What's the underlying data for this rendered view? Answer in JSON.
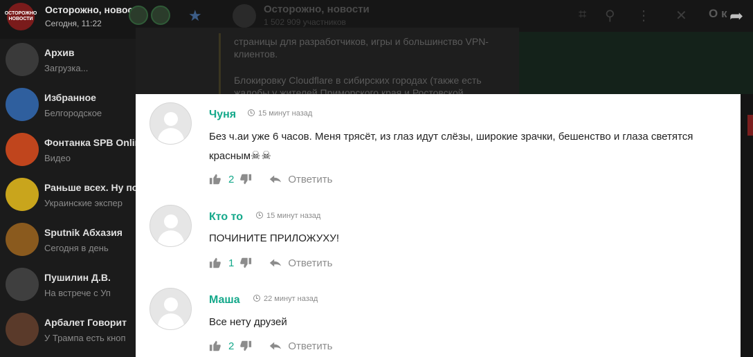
{
  "topbar": {
    "channel_logo_text": "ОСТОРОЖНО НОВОСТИ",
    "title": "Осторожно, новости",
    "time": "Сегодня, 11:22",
    "chat_title": "Осторожно, новости",
    "chat_subscribers": "1 502 909 участников",
    "right_partial": "О к"
  },
  "sidebar": {
    "chats": [
      {
        "name": "Архив",
        "preview": "Загрузка...",
        "avatar_color": "#3a3a3a"
      },
      {
        "name": "Избранное",
        "preview": "Белгородское",
        "avatar_color": "#2f5f9e"
      },
      {
        "name": "Фонтанка SPB Onlin",
        "preview": "Видео",
        "avatar_color": "#c0451d"
      },
      {
        "name": "Раньше всех. Ну по",
        "preview": "Украинские экспер",
        "avatar_color": "#c9a51c"
      },
      {
        "name": "Sputnik Абхазия",
        "preview": "Сегодня в день",
        "avatar_color": "#8a5a1e"
      },
      {
        "name": "Пушилин Д.В.",
        "preview": "На встрече с Уп",
        "avatar_color": "#3f3f3f"
      },
      {
        "name": "Арбалет Говорит",
        "preview": "У Трампа есть кноп",
        "avatar_color": "#5a3a2a"
      }
    ]
  },
  "background_message": {
    "lines": [
      "страницы для разработчиков, игры и большинство VPN-",
      "клиентов.",
      "Блокировку Cloudflare в сибирских городах (также есть",
      "жалобы у жителей Приморского края и Ростовской"
    ]
  },
  "comments": [
    {
      "author": "Чуня",
      "time": "15 минут назад",
      "text": "Без ч.аи уже 6 часов. Меня трясёт, из глаз идут слёзы, широкие зрачки, бешенство и глаза светятся красным",
      "emoji": "☠☠",
      "likes": "2",
      "dislikes": "",
      "reply": "Ответить"
    },
    {
      "author": "Кто то",
      "time": "15 минут назад",
      "text": "ПОЧИНИТЕ ПРИЛОЖУХУ!",
      "emoji": "",
      "likes": "1",
      "dislikes": "",
      "reply": "Ответить"
    },
    {
      "author": "Маша",
      "time": "22 минут назад",
      "text": "Все нету друзей",
      "emoji": "",
      "likes": "2",
      "dislikes": "",
      "reply": "Ответить"
    }
  ],
  "colors": {
    "accent": "#14a88a",
    "muted": "#8c8c8c",
    "text": "#222222"
  }
}
